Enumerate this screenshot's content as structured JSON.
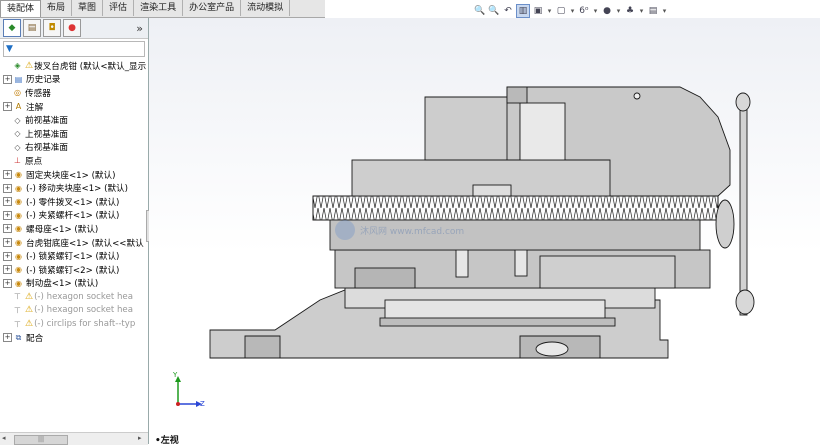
{
  "top_tabs": [
    "装配体",
    "布局",
    "草图",
    "评估",
    "渲染工具",
    "办公室产品",
    "流动模拟"
  ],
  "active_tab": 0,
  "view_toolbar": [
    {
      "icon": "zoom-to-fit-icon",
      "glyph": "🔍"
    },
    {
      "icon": "zoom-area-icon",
      "glyph": "🔍"
    },
    {
      "icon": "previous-view-icon",
      "glyph": "↶"
    },
    {
      "icon": "section-view-icon",
      "glyph": "▥",
      "active": true
    },
    {
      "icon": "view-orientation-icon",
      "glyph": "▣",
      "dropdown": true
    },
    {
      "icon": "display-style-icon",
      "glyph": "▢",
      "dropdown": true
    },
    {
      "icon": "hide-show-items-icon",
      "glyph": "6ᵒ",
      "dropdown": true
    },
    {
      "icon": "edit-appearance-icon",
      "glyph": "●",
      "dropdown": true
    },
    {
      "icon": "apply-scene-icon",
      "glyph": "♣",
      "dropdown": true
    },
    {
      "icon": "view-settings-icon",
      "glyph": "▤",
      "dropdown": true
    }
  ],
  "panel": {
    "expand_label": "»",
    "filter_label": "▼"
  },
  "tree": [
    {
      "label": "拨叉台虎钳 (默认<默认_显示",
      "type": "root",
      "icon": "assembly-icon",
      "warn": true
    },
    {
      "label": "历史记录",
      "exp": true,
      "icon": "history-icon"
    },
    {
      "label": "传感器",
      "icon": "sensor-icon"
    },
    {
      "label": "注解",
      "exp": true,
      "icon": "annotation-icon"
    },
    {
      "label": "前视基准面",
      "icon": "plane-icon"
    },
    {
      "label": "上视基准面",
      "icon": "plane-icon"
    },
    {
      "label": "右视基准面",
      "icon": "plane-icon"
    },
    {
      "label": "原点",
      "icon": "origin-icon"
    },
    {
      "label": "固定夹块座<1> (默认)",
      "exp": true,
      "icon": "part-icon"
    },
    {
      "label": "(-) 移动夹块座<1> (默认)",
      "exp": true,
      "icon": "part-icon"
    },
    {
      "label": "(-) 零件拨叉<1> (默认)",
      "exp": true,
      "icon": "part-icon"
    },
    {
      "label": "(-) 夹紧螺杆<1> (默认)",
      "exp": true,
      "icon": "part-icon"
    },
    {
      "label": "螺母座<1> (默认)",
      "exp": true,
      "icon": "part-icon"
    },
    {
      "label": "台虎钳底座<1> (默认<<默认",
      "exp": true,
      "icon": "part-icon"
    },
    {
      "label": "(-) 锁紧螺钉<1> (默认)",
      "exp": true,
      "icon": "part-icon"
    },
    {
      "label": "(-) 锁紧螺钉<2> (默认)",
      "exp": true,
      "icon": "part-icon"
    },
    {
      "label": "制动盘<1> (默认)",
      "exp": true,
      "icon": "part-icon"
    },
    {
      "label": "(-) hexagon socket hea",
      "icon": "toolbox-part-icon",
      "warn": true,
      "gray": true
    },
    {
      "label": "(-) hexagon socket hea",
      "icon": "toolbox-part-icon",
      "warn": true,
      "gray": true
    },
    {
      "label": "(-) circlips for shaft--typ",
      "icon": "toolbox-part-icon",
      "warn": true,
      "gray": true
    },
    {
      "label": "配合",
      "exp": true,
      "icon": "mates-icon"
    }
  ],
  "scrollbar": {
    "thumb_label": "|||",
    "left_arrow": "◂",
    "right_arrow": "▸"
  },
  "triad": {
    "y_label": "Y",
    "z_label": "Z"
  },
  "view_name": "•左视",
  "watermark": "沐风网 www.mfcad.com",
  "colors": {
    "part_fill": "#cdcdcd",
    "part_dark": "#9a9a9a",
    "outline": "#1a1a1a",
    "accent": "#6b8fc9"
  }
}
